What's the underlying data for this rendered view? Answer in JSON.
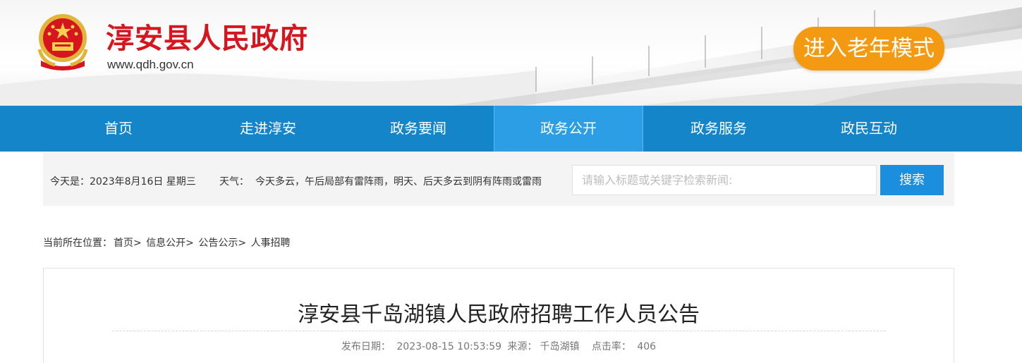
{
  "header": {
    "site_title": "淳安县人民政府",
    "site_url": "www.qdh.gov.cn",
    "elder_mode_button": "进入老年模式"
  },
  "nav": {
    "items": [
      {
        "label": "首页"
      },
      {
        "label": "走进淳安"
      },
      {
        "label": "政务要闻"
      },
      {
        "label": "政务公开"
      },
      {
        "label": "政务服务"
      },
      {
        "label": "政民互动"
      }
    ],
    "active_index": 3
  },
  "infobar": {
    "today": "今天是：2023年8月16日 星期三",
    "weather_label": "天气：",
    "weather_text": "今天多云，午后局部有雷阵雨，明天、后天多云到阴有阵雨或雷雨"
  },
  "search": {
    "placeholder": "请输入标题或关键字检索新闻:",
    "button_label": "搜索"
  },
  "breadcrumb": {
    "prefix": "当前所在位置：",
    "items": [
      "首页>",
      "信息公开>",
      "公告公示>",
      "人事招聘"
    ]
  },
  "article": {
    "title": "淳安县千岛湖镇人民政府招聘工作人员公告",
    "publish_label": "发布日期：",
    "publish_date": "2023-08-15 10:53:59",
    "source_label": "来源：",
    "source": "千岛湖镇",
    "clicks_label": "点击率：",
    "clicks": "406"
  },
  "colors": {
    "brand_red": "#d7151e",
    "nav_blue": "#1585c9",
    "nav_active": "#2b9ee6",
    "elder_orange": "#f39a12",
    "search_blue": "#1b8fde"
  }
}
